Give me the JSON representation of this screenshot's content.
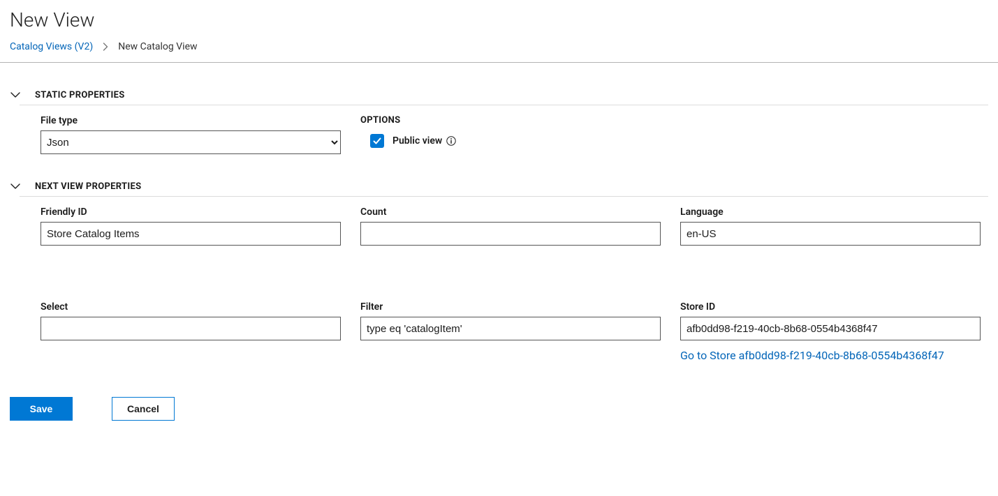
{
  "header": {
    "title": "New View"
  },
  "breadcrumb": {
    "link_label": "Catalog Views (V2)",
    "current": "New Catalog View"
  },
  "sections": {
    "static_properties": {
      "title": "STATIC PROPERTIES",
      "file_type": {
        "label": "File type",
        "value": "Json"
      },
      "options": {
        "title": "OPTIONS",
        "public_view": {
          "label": "Public view",
          "checked": true
        }
      }
    },
    "next_view_properties": {
      "title": "NEXT VIEW PROPERTIES",
      "friendly_id": {
        "label": "Friendly ID",
        "value": "Store Catalog Items"
      },
      "count": {
        "label": "Count",
        "value": ""
      },
      "language": {
        "label": "Language",
        "value": "en-US"
      },
      "select": {
        "label": "Select",
        "value": ""
      },
      "filter": {
        "label": "Filter",
        "value": "type eq 'catalogItem'"
      },
      "store_id": {
        "label": "Store ID",
        "value": "afb0dd98-f219-40cb-8b68-0554b4368f47",
        "link_text": "Go to Store afb0dd98-f219-40cb-8b68-0554b4368f47"
      }
    }
  },
  "buttons": {
    "save": "Save",
    "cancel": "Cancel"
  }
}
